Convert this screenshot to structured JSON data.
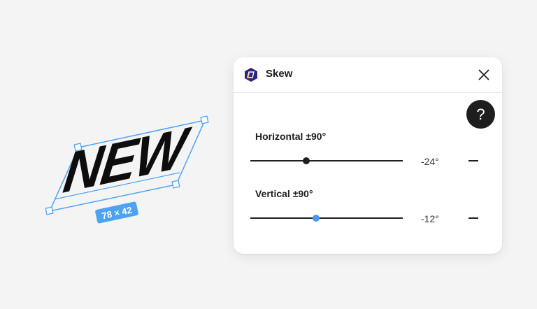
{
  "canvas": {
    "object_text": "NEW",
    "size_badge": "78 × 42",
    "selection_color": "#4da3f2"
  },
  "panel": {
    "title": "Skew",
    "icon": "skew-icon",
    "close_icon": "close-icon",
    "help_label": "?",
    "fields": [
      {
        "label": "Horizontal ±90°",
        "value": "-24°",
        "degrees": -24,
        "thumb_color": "#1f1f1f"
      },
      {
        "label": "Vertical ±90°",
        "value": "-12°",
        "degrees": -12,
        "thumb_color": "#4b99f5"
      }
    ]
  },
  "colors": {
    "background": "#f4f4f4",
    "panel": "#ffffff",
    "icon_bg": "#2b2480",
    "accent": "#4da3f2"
  }
}
